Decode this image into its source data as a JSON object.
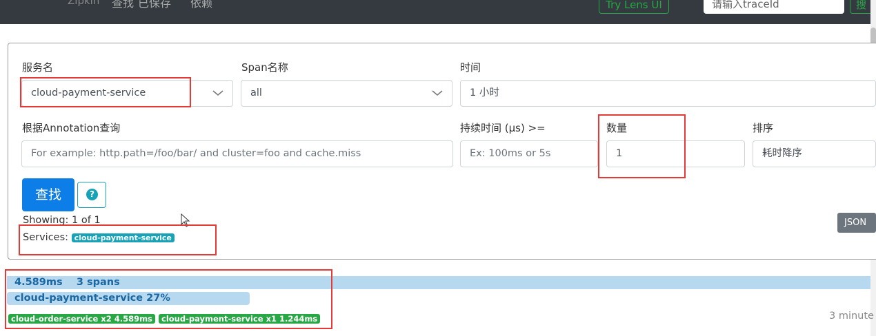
{
  "nav": {
    "brand": "Zipkin",
    "links": [
      "查找",
      "已保存",
      "依赖"
    ],
    "lens_button": "Try Lens UI",
    "traceid_placeholder": "请输入traceId",
    "go_button": "搜"
  },
  "form": {
    "service_label": "服务名",
    "service_value": "cloud-payment-service",
    "span_label": "Span名称",
    "span_value": "all",
    "time_label": "时间",
    "time_value": "1 小时",
    "annotation_label": "根据Annotation查询",
    "annotation_placeholder": "For example: http.path=/foo/bar/ and cluster=foo and cache.miss",
    "duration_label": "持续时间 (μs) >=",
    "duration_placeholder": "Ex: 100ms or 5s",
    "limit_label": "数量",
    "limit_value": "1",
    "sort_label": "排序",
    "sort_value": "耗时降序",
    "search_button": "查找",
    "help_icon_glyph": "?"
  },
  "results": {
    "showing": "Showing: 1 of 1",
    "services_label": "Services:",
    "services": [
      "cloud-payment-service"
    ],
    "json_button": "JSON"
  },
  "trace": {
    "duration": "4.589ms",
    "spans": "3 spans",
    "service_percent": "cloud-payment-service 27%",
    "service_badges": [
      "cloud-order-service x2 4.589ms",
      "cloud-payment-service x1 1.244ms"
    ],
    "time_ago": "3 minute"
  },
  "colors": {
    "primary": "#0d7de8",
    "info": "#17a2b8",
    "success": "#28a745",
    "highlight_box": "#e53935",
    "trace_bar": "#b7d9f0"
  }
}
